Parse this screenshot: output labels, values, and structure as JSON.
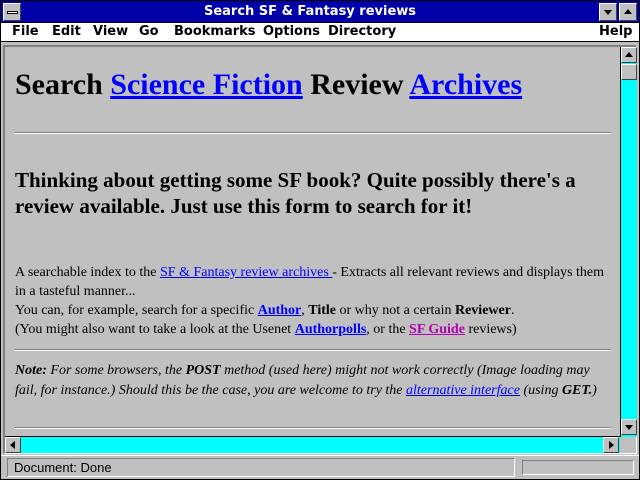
{
  "window": {
    "title": "Search SF & Fantasy reviews"
  },
  "menu": {
    "file": "File",
    "edit": "Edit",
    "view": "View",
    "go": "Go",
    "bookmarks": "Bookmarks",
    "options": "Options",
    "directory": "Directory",
    "help": "Help"
  },
  "page": {
    "heading": {
      "part1": "Search ",
      "link1": "Science Fiction",
      "part2": " Review ",
      "link2": "Archives"
    },
    "subheading": "Thinking about getting some SF book? Quite possibly there's a review available. Just use this form to search for it!",
    "intro": {
      "t1": "A searchable index to the ",
      "link": "SF & Fantasy review archives ",
      "t2": "- Extracts all relevant reviews and displays them in a tasteful manner..."
    },
    "line2": {
      "t1": "You can, for example, search for a specific ",
      "author": "Author",
      "t2": ", ",
      "title": "Title",
      "t3": " or why not a certain ",
      "reviewer": "Reviewer",
      "t4": "."
    },
    "line3": {
      "t1": "(You might also want to take a look at the Usenet ",
      "authorpolls": "Authorpolls",
      "t2": ", or the ",
      "sfguide": "SF Guide",
      "t3": " reviews)"
    },
    "note": {
      "label": "Note:",
      "t1": " For some browsers, the ",
      "post": "POST",
      "t2": " method (used here) might not work correctly (Image loading may fail, for instance.) Should this be the case, you are welcome to try the ",
      "alt": "alternative interface",
      "t3": " (using ",
      "get": "GET.",
      "t4": ")"
    }
  },
  "status": {
    "text": "Document: Done"
  },
  "colors": {
    "titlebar": "#0000a8",
    "link": "#0000ff",
    "visited_link": "#b000b0",
    "scroll_track": "#00ffff",
    "background": "#c0c0c0"
  },
  "icons": [
    "system-menu-icon",
    "minimize-icon",
    "maximize-icon",
    "scroll-up-icon",
    "scroll-down-icon",
    "scroll-left-icon",
    "scroll-right-icon"
  ]
}
